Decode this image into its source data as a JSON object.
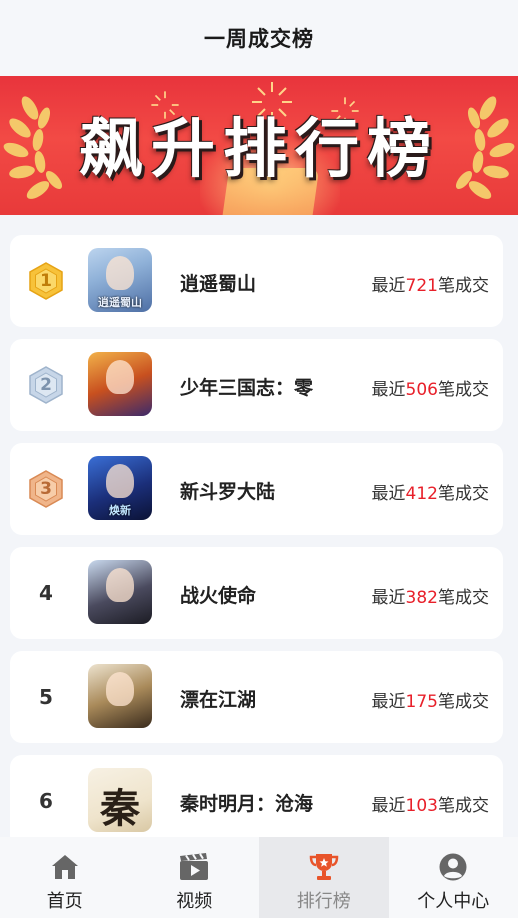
{
  "header": {
    "title": "一周成交榜"
  },
  "banner": {
    "text": "飙升排行榜"
  },
  "deals_format": {
    "prefix": "最近",
    "suffix": "笔成交"
  },
  "colors": {
    "accent": "#e8202a",
    "banner": "#e8343c",
    "nav_active": "#e8542a"
  },
  "list": [
    {
      "rank": "1",
      "badge": "gold",
      "name": "逍遥蜀山",
      "count": "721",
      "thumb_caption": "逍遥蜀山",
      "icon": "game-icon-xiaoyao-shushan"
    },
    {
      "rank": "2",
      "badge": "silver",
      "name": "少年三国志：零",
      "count": "506",
      "thumb_caption": "",
      "icon": "game-icon-shaonian-sanguozhi"
    },
    {
      "rank": "3",
      "badge": "bronze",
      "name": "新斗罗大陆",
      "count": "412",
      "thumb_caption": "焕新",
      "icon": "game-icon-xin-douluo-dalu"
    },
    {
      "rank": "4",
      "badge": "none",
      "name": "战火使命",
      "count": "382",
      "thumb_caption": "",
      "icon": "game-icon-zhanhuo-shiming"
    },
    {
      "rank": "5",
      "badge": "none",
      "name": "漂在江湖",
      "count": "175",
      "thumb_caption": "",
      "icon": "game-icon-piao-zai-jianghu"
    },
    {
      "rank": "6",
      "badge": "none",
      "name": "秦时明月：沧海",
      "count": "103",
      "thumb_caption": "秦",
      "icon": "game-icon-qinshi-mingyue"
    }
  ],
  "nav": [
    {
      "label": "首页",
      "icon": "home-icon",
      "active": false
    },
    {
      "label": "视频",
      "icon": "video-icon",
      "active": false
    },
    {
      "label": "排行榜",
      "icon": "trophy-icon",
      "active": true
    },
    {
      "label": "个人中心",
      "icon": "user-icon",
      "active": false
    }
  ]
}
